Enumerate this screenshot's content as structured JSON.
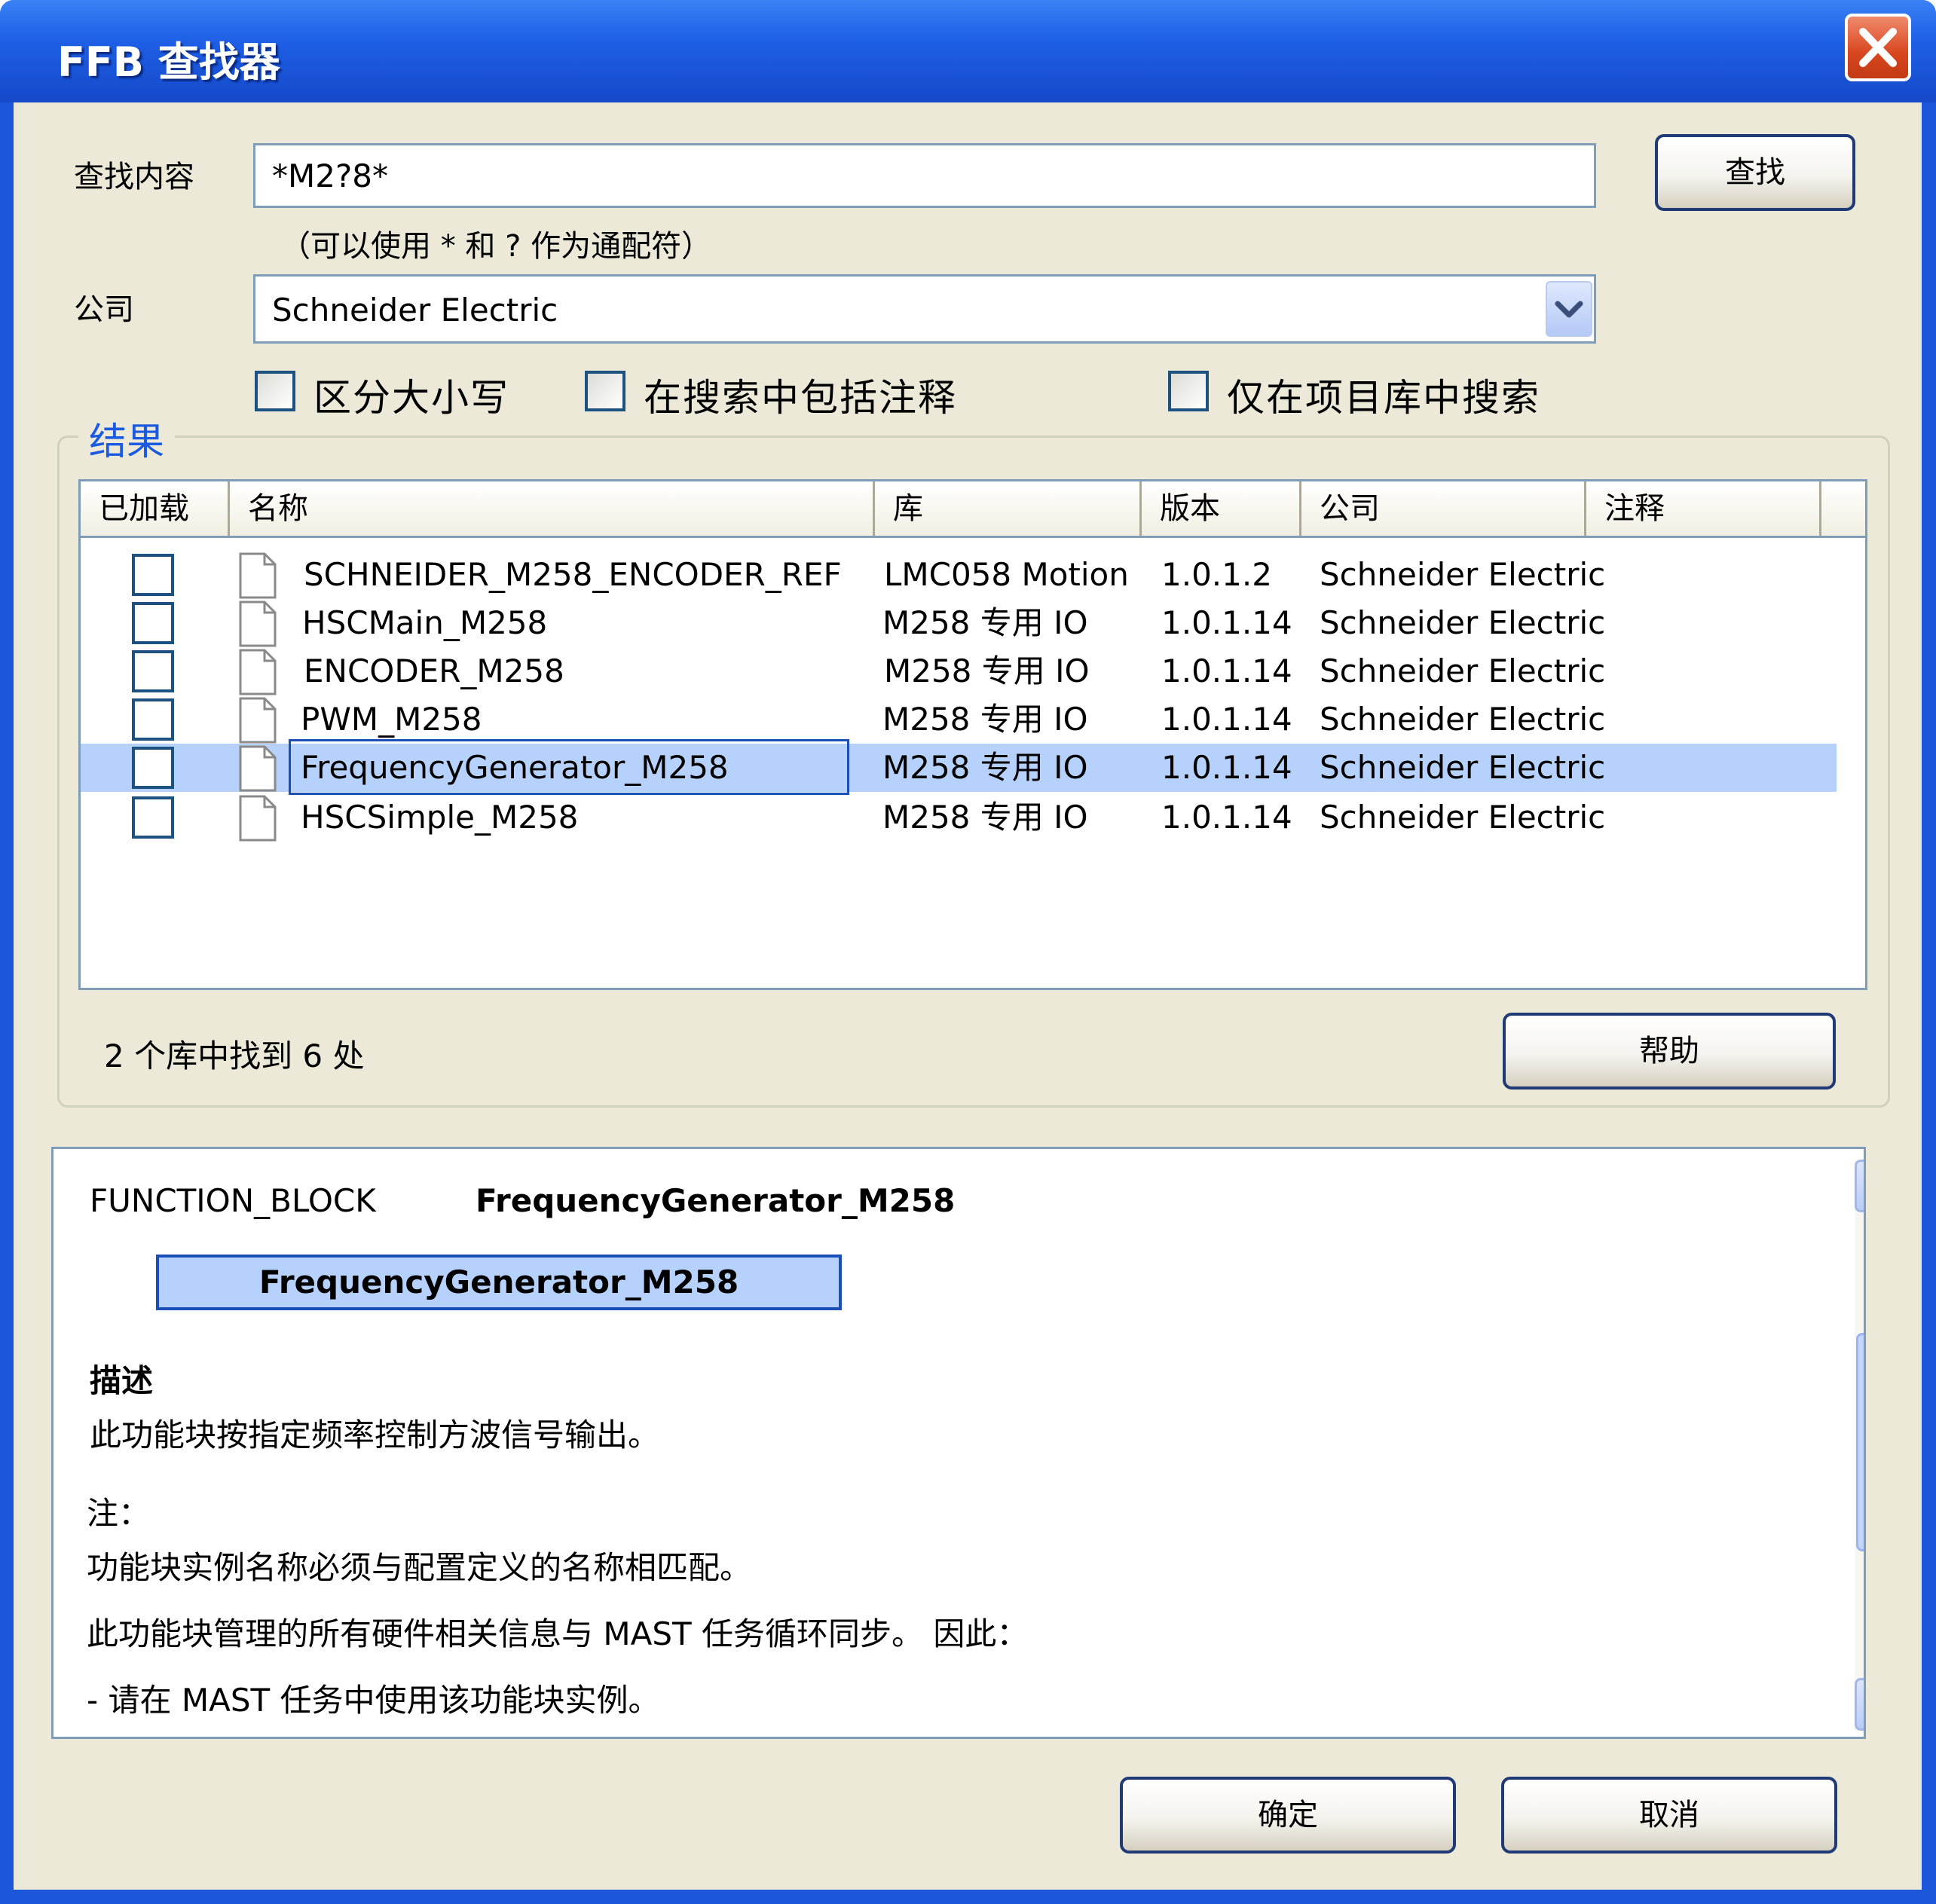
{
  "window": {
    "title": "FFB 查找器",
    "close_icon": "close-icon"
  },
  "search": {
    "label": "查找内容",
    "value": "*M2?8*",
    "hint": "（可以使用 * 和 ? 作为通配符）",
    "find_button": "查找"
  },
  "company": {
    "label": "公司",
    "selected": "Schneider Electric",
    "dropdown_icon": "chevron-down-icon"
  },
  "options": {
    "case_sensitive": {
      "label": "区分大小写",
      "checked": false
    },
    "include_comments": {
      "label": "在搜索中包括注释",
      "checked": false
    },
    "project_lib_only": {
      "label": "仅在项目库中搜索",
      "checked": false
    }
  },
  "results": {
    "group_title": "结果",
    "columns": [
      "已加载",
      "名称",
      "库",
      "版本",
      "公司",
      "注释"
    ],
    "rows": [
      {
        "loaded": false,
        "name": "SCHNEIDER_M258_ENCODER_REF",
        "library": "LMC058 Motion",
        "version": "1.0.1.2",
        "company": "Schneider Electric",
        "comment": ""
      },
      {
        "loaded": false,
        "name": "HSCMain_M258",
        "library": "M258 专用 IO",
        "version": "1.0.1.14",
        "company": "Schneider Electric",
        "comment": ""
      },
      {
        "loaded": false,
        "name": "ENCODER_M258",
        "library": "M258 专用 IO",
        "version": "1.0.1.14",
        "company": "Schneider Electric",
        "comment": ""
      },
      {
        "loaded": false,
        "name": "PWM_M258",
        "library": "M258 专用 IO",
        "version": "1.0.1.14",
        "company": "Schneider Electric",
        "comment": ""
      },
      {
        "loaded": false,
        "name": "FrequencyGenerator_M258",
        "library": "M258 专用 IO",
        "version": "1.0.1.14",
        "company": "Schneider Electric",
        "comment": "",
        "selected": true
      },
      {
        "loaded": false,
        "name": "HSCSimple_M258",
        "library": "M258 专用 IO",
        "version": "1.0.1.14",
        "company": "Schneider Electric",
        "comment": ""
      }
    ],
    "status": "2 个库中找到 6 处",
    "help_button": "帮助"
  },
  "detail": {
    "kind": "FUNCTION_BLOCK",
    "name": "FrequencyGenerator_M258",
    "block_name": "FrequencyGenerator_M258",
    "description_heading": "描述",
    "description": "此功能块按指定频率控制方波信号输出。",
    "note_heading": "注：",
    "note_1": "功能块实例名称必须与配置定义的名称相匹配。",
    "note_2": "此功能块管理的所有硬件相关信息与 MAST 任务循环同步。 因此：",
    "note_3": "- 请在 MAST 任务中使用该功能块实例。"
  },
  "footer": {
    "ok_button": "确定",
    "cancel_button": "取消"
  },
  "colors": {
    "titlebar": "#1e5fe6",
    "client_bg": "#ece9d8",
    "selection": "#b6d1fb",
    "group_title": "#1a5be0",
    "close_button": "#d8461e"
  }
}
